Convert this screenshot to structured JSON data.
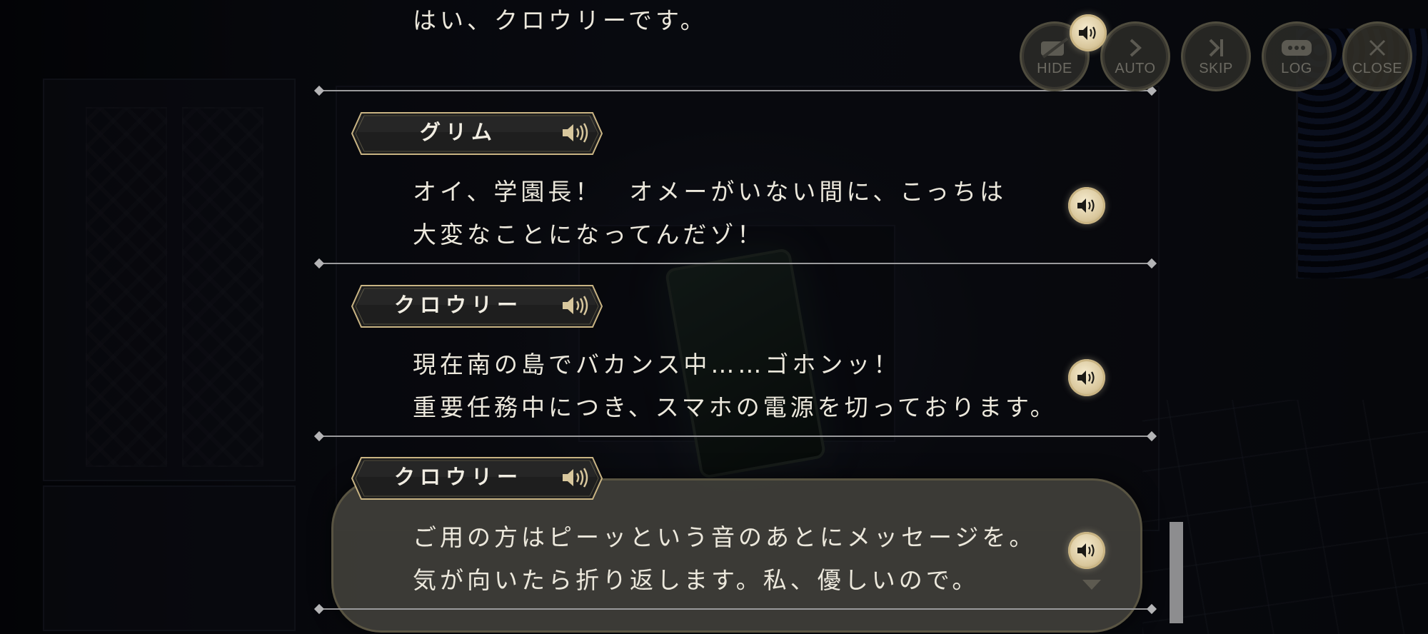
{
  "menu": {
    "hide": "HIDE",
    "auto": "AUTO",
    "skip": "SKIP",
    "log": "LOG",
    "close": "CLOSE"
  },
  "entries": [
    {
      "speaker": "",
      "lines": [
        "はい、クロウリーです。"
      ]
    },
    {
      "speaker": "グリム",
      "lines": [
        "オイ、学園長！　オメーがいない間に、こっちは",
        "大変なことになってんだゾ！"
      ]
    },
    {
      "speaker": "クロウリー",
      "lines": [
        "現在南の島でバカンス中……ゴホンッ！",
        "重要任務中につき、スマホの電源を切っております。"
      ]
    },
    {
      "speaker": "クロウリー",
      "lines": [
        "ご用の方はピーッという音のあとにメッセージを。",
        "気が向いたら折り返します。私、優しいので。"
      ]
    }
  ],
  "colors": {
    "gold": "#c9b483",
    "text": "#ece8dc",
    "plate": "#222222"
  },
  "icons": [
    "speaker-icon",
    "hide-icon",
    "auto-icon",
    "skip-icon",
    "log-icon",
    "close-icon",
    "chevron-down-icon"
  ]
}
